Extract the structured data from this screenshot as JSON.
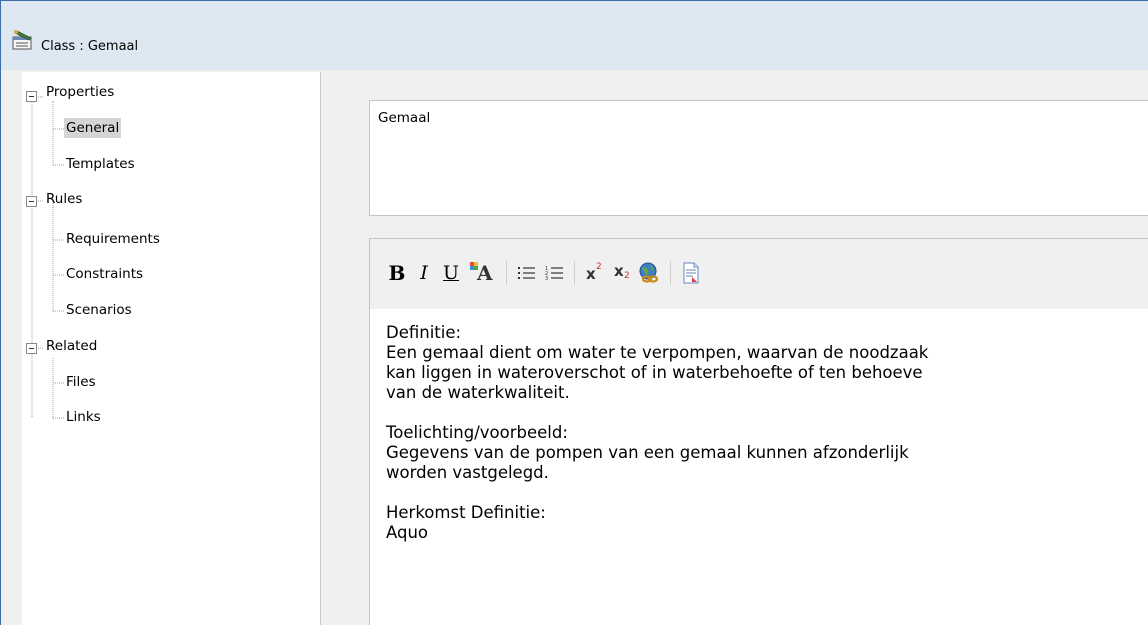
{
  "window": {
    "title": "Class : Gemaal"
  },
  "tree": {
    "items": [
      {
        "label": "Properties",
        "level": 0,
        "expanded": true
      },
      {
        "label": "General",
        "level": 1,
        "selected": true
      },
      {
        "label": "Templates",
        "level": 1
      },
      {
        "label": "Rules",
        "level": 0,
        "expanded": true
      },
      {
        "label": "Requirements",
        "level": 1
      },
      {
        "label": "Constraints",
        "level": 1
      },
      {
        "label": "Scenarios",
        "level": 1
      },
      {
        "label": "Related",
        "level": 0,
        "expanded": true
      },
      {
        "label": "Files",
        "level": 1
      },
      {
        "label": "Links",
        "level": 1
      }
    ]
  },
  "name_field": {
    "value": "Gemaal"
  },
  "toolbar": {
    "bold": "B",
    "italic": "I",
    "underline": "U",
    "font_color": "A",
    "superscript_base": "x",
    "superscript_exp": "2",
    "subscript_base": "x",
    "subscript_exp": "2"
  },
  "notes": {
    "lines": [
      "Definitie:",
      "Een gemaal dient om water te verpompen, waarvan de noodzaak",
      "kan liggen in wateroverschot of in waterbehoefte of ten behoeve",
      "van de waterkwaliteit.",
      "",
      "Toelichting/voorbeeld:",
      "Gegevens van de pompen van een gemaal kunnen afzonderlijk",
      "worden vastgelegd.",
      "",
      "Herkomst Definitie:",
      "Aquo"
    ]
  },
  "colors": {
    "window_border": "#3d6da8",
    "titlebar_bg": "#dee8f2",
    "selection_bg": "#d5d5d5"
  }
}
